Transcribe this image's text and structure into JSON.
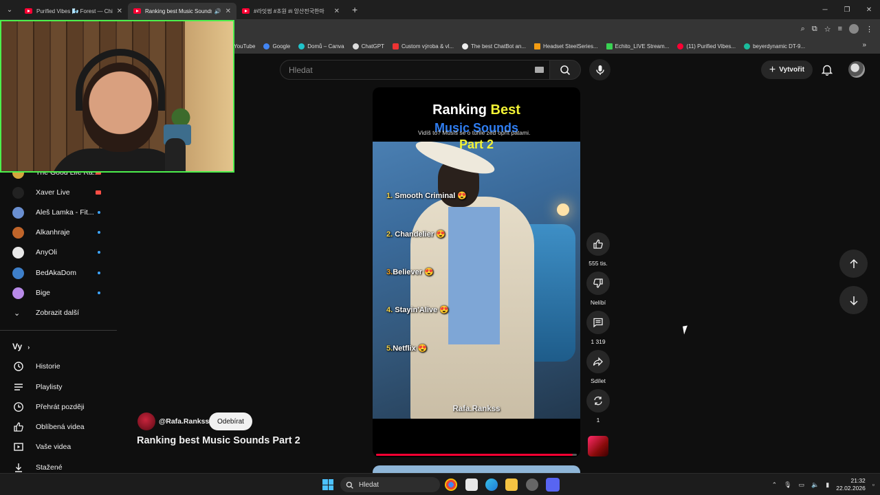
{
  "browser": {
    "tabs": [
      {
        "title": "Purified Vibes 🌬️ Forest — Chi",
        "active": false
      },
      {
        "title": "Ranking best Music Sounds",
        "active": true
      },
      {
        "title": "#라잇썸 #초원 #i 앙산전국한마",
        "active": false
      }
    ],
    "bookmarks": [
      "YouTube",
      "Google",
      "Domů – Canva",
      "ChatGPT",
      "Custom výroba & vl...",
      "The best ChatBot an...",
      "Headset SteelSeries...",
      "Echito_LIVE Stream...",
      "(11) Purified Vibes...",
      "beyerdynamic DT-9..."
    ]
  },
  "masthead": {
    "search_placeholder": "Hledat",
    "create_label": "Vytvořit"
  },
  "sidebar": {
    "subscriptions": [
      {
        "name": "The Good Life Ra...",
        "color": "#d4a53c",
        "indicator": "live"
      },
      {
        "name": "Xaver Live",
        "color": "#222222",
        "indicator": "live"
      },
      {
        "name": "Aleš Lamka - Fit...",
        "color": "#6a8fd0",
        "indicator": "dot"
      },
      {
        "name": "Alkanhraje",
        "color": "#c0652a",
        "indicator": "dot"
      },
      {
        "name": "AnyOli",
        "color": "#e8e8e8",
        "indicator": "dot"
      },
      {
        "name": "BedAkaDom",
        "color": "#3e7fc9",
        "indicator": "dot"
      },
      {
        "name": "Bige",
        "color": "#b88ae8",
        "indicator": "dot"
      }
    ],
    "show_more": "Zobrazit další",
    "you_heading": "Vy",
    "you_items": [
      {
        "label": "Historie",
        "icon": "history-icon"
      },
      {
        "label": "Playlisty",
        "icon": "playlist-icon"
      },
      {
        "label": "Přehrát později",
        "icon": "watch-later-icon"
      },
      {
        "label": "Oblíbená videa",
        "icon": "like-icon"
      },
      {
        "label": "Vaše videa",
        "icon": "your-videos-icon"
      },
      {
        "label": "Stažené",
        "icon": "download-icon"
      }
    ]
  },
  "short": {
    "title_line1_white": "Ranking",
    "title_line1_yellow": "Best",
    "title_line2": "Music Sounds",
    "title_line3": "Part 2",
    "caption": "Vidíš to? Musíš se o tuhle zeď opřít patami.",
    "rankings": [
      {
        "num": "1.",
        "name": "Smooth Criminal"
      },
      {
        "num": "2.",
        "name": "Chandelier"
      },
      {
        "num": "3.",
        "name": "Believer"
      },
      {
        "num": "4.",
        "name": "Stayin'Alive"
      },
      {
        "num": "5.",
        "name": "Netflix"
      }
    ],
    "watermark": "Rafa.Rankss",
    "progress": 0.98
  },
  "actions": {
    "like_count": "555 tis.",
    "dislike_label": "Nelíbí",
    "comments_count": "1 319",
    "share_label": "Sdílet",
    "remix_count": "1"
  },
  "channel": {
    "handle": "@Rafa.Rankss",
    "subscribe_label": "Odebírat"
  },
  "video_title": "Ranking best Music Sounds Part 2",
  "taskbar": {
    "search_label": "Hledat",
    "time": "21:32",
    "date": "22.02.2026"
  }
}
